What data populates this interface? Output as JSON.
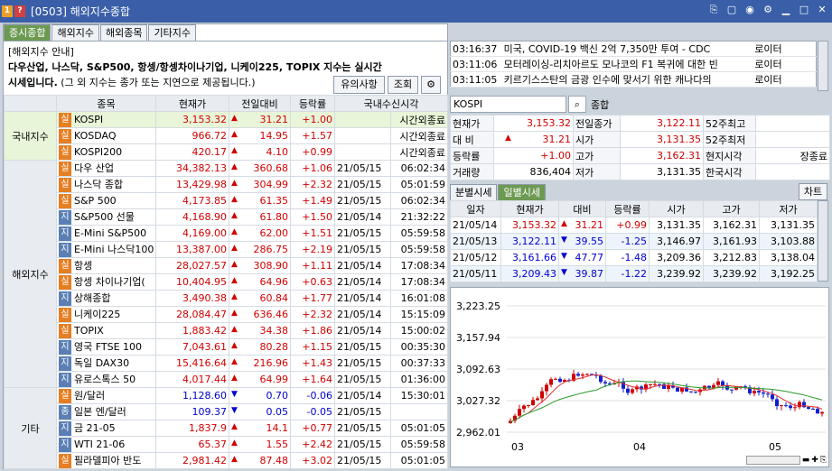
{
  "window": {
    "badge1": "1",
    "badge2": "?",
    "title": "[0503] 해외지수종합"
  },
  "tabs": [
    "증시종합",
    "해외지수",
    "해외종목",
    "기타지수"
  ],
  "notice": {
    "line1": "[해외지수 안내]",
    "line2": "다우산업, 나스닥, S&P500, 항셍/항셍차이나기업, 니케이225, TOPIX 지수는 실시간",
    "line3": "시세입니다.",
    "line3b": " (그 외 지수는 종가 또는 지연으로 제공됩니다.)"
  },
  "buttons": {
    "caution": "유의사항",
    "query": "조회"
  },
  "table": {
    "headers": [
      "종목",
      "현재가",
      "전일대비",
      "등락률",
      "국내수신시각"
    ],
    "groups": [
      {
        "name": "국내지수",
        "rows": [
          {
            "tag": "실",
            "name": "KOSPI",
            "price": "3,153.32",
            "dir": "up",
            "chg": "31.21",
            "rate": "+1.00",
            "date": "",
            "time": "시간외종료"
          },
          {
            "tag": "실",
            "name": "KOSDAQ",
            "price": "966.72",
            "dir": "up",
            "chg": "14.95",
            "rate": "+1.57",
            "date": "",
            "time": "시간외종료"
          },
          {
            "tag": "실",
            "name": "KOSPI200",
            "price": "420.17",
            "dir": "up",
            "chg": "4.10",
            "rate": "+0.99",
            "date": "",
            "time": "시간외종료"
          }
        ]
      },
      {
        "name": "해외지수",
        "rows": [
          {
            "tag": "실",
            "name": "다우 산업",
            "price": "34,382.13",
            "dir": "up",
            "chg": "360.68",
            "rate": "+1.06",
            "date": "21/05/15",
            "time": "06:02:34"
          },
          {
            "tag": "실",
            "name": "나스닥 종합",
            "price": "13,429.98",
            "dir": "up",
            "chg": "304.99",
            "rate": "+2.32",
            "date": "21/05/15",
            "time": "05:01:59"
          },
          {
            "tag": "실",
            "name": "S&P 500",
            "price": "4,173.85",
            "dir": "up",
            "chg": "61.35",
            "rate": "+1.49",
            "date": "21/05/15",
            "time": "06:02:34"
          },
          {
            "tag": "지",
            "name": "S&P500 선물",
            "price": "4,168.90",
            "dir": "up",
            "chg": "61.80",
            "rate": "+1.50",
            "date": "21/05/14",
            "time": "21:32:22"
          },
          {
            "tag": "지",
            "name": "E-Mini S&P500",
            "price": "4,169.00",
            "dir": "up",
            "chg": "62.00",
            "rate": "+1.51",
            "date": "21/05/15",
            "time": "05:59:58"
          },
          {
            "tag": "지",
            "name": "E-Mini 나스닥100",
            "price": "13,387.00",
            "dir": "up",
            "chg": "286.75",
            "rate": "+2.19",
            "date": "21/05/15",
            "time": "05:59:58"
          },
          {
            "tag": "실",
            "name": "항셍",
            "price": "28,027.57",
            "dir": "up",
            "chg": "308.90",
            "rate": "+1.11",
            "date": "21/05/14",
            "time": "17:08:34"
          },
          {
            "tag": "실",
            "name": "항셍 차이나기업(",
            "price": "10,404.95",
            "dir": "up",
            "chg": "64.96",
            "rate": "+0.63",
            "date": "21/05/14",
            "time": "17:08:34"
          },
          {
            "tag": "지",
            "name": "상해종합",
            "price": "3,490.38",
            "dir": "up",
            "chg": "60.84",
            "rate": "+1.77",
            "date": "21/05/14",
            "time": "16:01:08"
          },
          {
            "tag": "실",
            "name": "니케이225",
            "price": "28,084.47",
            "dir": "up",
            "chg": "636.46",
            "rate": "+2.32",
            "date": "21/05/14",
            "time": "15:15:09"
          },
          {
            "tag": "실",
            "name": "TOPIX",
            "price": "1,883.42",
            "dir": "up",
            "chg": "34.38",
            "rate": "+1.86",
            "date": "21/05/14",
            "time": "15:00:02"
          },
          {
            "tag": "지",
            "name": "영국 FTSE 100",
            "price": "7,043.61",
            "dir": "up",
            "chg": "80.28",
            "rate": "+1.15",
            "date": "21/05/15",
            "time": "00:35:30"
          },
          {
            "tag": "지",
            "name": "독일 DAX30",
            "price": "15,416.64",
            "dir": "up",
            "chg": "216.96",
            "rate": "+1.43",
            "date": "21/05/15",
            "time": "00:37:33"
          },
          {
            "tag": "지",
            "name": "유로스톡스 50",
            "price": "4,017.44",
            "dir": "up",
            "chg": "64.99",
            "rate": "+1.64",
            "date": "21/05/15",
            "time": "01:36:00"
          }
        ]
      },
      {
        "name": "기타",
        "rows": [
          {
            "tag": "실",
            "name": "원/달러",
            "price": "1,128.60",
            "dir": "dn",
            "chg": "0.70",
            "rate": "-0.06",
            "date": "21/05/14",
            "time": "15:30:01"
          },
          {
            "tag": "종",
            "name": "일본 엔/달러",
            "price": "109.37",
            "dir": "dn",
            "chg": "0.05",
            "rate": "-0.05",
            "date": "21/05/15",
            "time": ""
          },
          {
            "tag": "지",
            "name": "금 21-05",
            "price": "1,837.9",
            "dir": "up",
            "chg": "14.1",
            "rate": "+0.77",
            "date": "21/05/15",
            "time": "05:01:05"
          },
          {
            "tag": "지",
            "name": "WTI 21-06",
            "price": "65.37",
            "dir": "up",
            "chg": "1.55",
            "rate": "+2.42",
            "date": "21/05/15",
            "time": "05:59:58"
          },
          {
            "tag": "실",
            "name": "필라델피아 반도",
            "price": "2,981.42",
            "dir": "up",
            "chg": "87.48",
            "rate": "+3.02",
            "date": "21/05/15",
            "time": "05:01:05"
          }
        ]
      }
    ]
  },
  "news": [
    {
      "time": "03:16:37",
      "text": "미국, COVID-19 백신 2억 7,350만 투여 - CDC",
      "src": "로이터"
    },
    {
      "time": "03:11:06",
      "text": "모터레이싱-리치아르도 모나코의 F1 복귀에 대한 빈",
      "src": "로이터"
    },
    {
      "time": "03:11:05",
      "text": "키르기스스탄의 금광 인수에 맞서기 위한 캐나다의",
      "src": "로이터"
    }
  ],
  "search": {
    "value": "KOSPI",
    "button": "종합"
  },
  "quote": {
    "r1": [
      "현재가",
      "3,153.32",
      "전일종가",
      "3,122.11",
      "52주최고",
      ""
    ],
    "r2": [
      "대 비",
      "31.21",
      "시가",
      "3,131.35",
      "52주최저",
      ""
    ],
    "r3": [
      "등락률",
      "+1.00",
      "고가",
      "3,162.31",
      "현지시각",
      "장종료"
    ],
    "r4": [
      "거래량",
      "836,404",
      "저가",
      "3,131.35",
      "한국시각",
      ""
    ]
  },
  "subtabs": [
    "분별시세",
    "일별시세"
  ],
  "chart_btn": "차트",
  "daily": {
    "headers": [
      "일자",
      "현재가",
      "대비",
      "등락률",
      "시가",
      "고가",
      "저가"
    ],
    "rows": [
      {
        "date": "21/05/14",
        "price": "3,153.32",
        "dir": "up",
        "chg": "31.21",
        "rate": "+0.99",
        "open": "3,131.35",
        "high": "3,162.31",
        "low": "3,131.35"
      },
      {
        "date": "21/05/13",
        "price": "3,122.11",
        "dir": "dn",
        "chg": "39.55",
        "rate": "-1.25",
        "open": "3,146.97",
        "high": "3,161.93",
        "low": "3,103.88"
      },
      {
        "date": "21/05/12",
        "price": "3,161.66",
        "dir": "dn",
        "chg": "47.77",
        "rate": "-1.48",
        "open": "3,209.36",
        "high": "3,212.83",
        "low": "3,138.04"
      },
      {
        "date": "21/05/11",
        "price": "3,209.43",
        "dir": "dn",
        "chg": "39.87",
        "rate": "-1.22",
        "open": "3,239.92",
        "high": "3,239.92",
        "low": "3,192.25"
      }
    ]
  },
  "chart_data": {
    "type": "candlestick",
    "yticks": [
      "3,223.25",
      "3,157.94",
      "3,092.63",
      "3,027.32",
      "2,962.01"
    ],
    "xticks": [
      "03",
      "04",
      "05"
    ],
    "ylim": [
      2962.01,
      3223.25
    ]
  }
}
